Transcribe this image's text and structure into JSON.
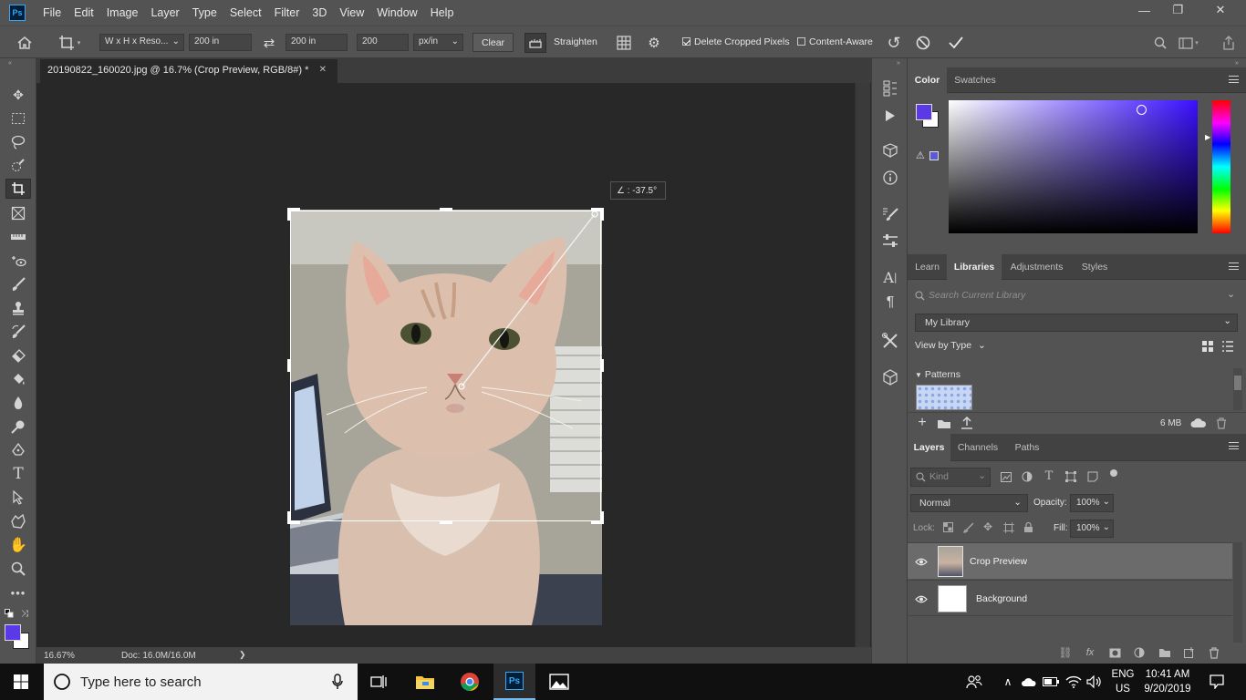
{
  "app": {
    "logo": "Ps"
  },
  "menu": [
    "File",
    "Edit",
    "Image",
    "Layer",
    "Type",
    "Select",
    "Filter",
    "3D",
    "View",
    "Window",
    "Help"
  ],
  "window_controls": {
    "minimize": "—",
    "restore": "❐",
    "close": "✕"
  },
  "options": {
    "ratio_preset": "W x H x Reso...",
    "width": "200 in",
    "height": "200 in",
    "resolution": "200",
    "resolution_unit": "px/in",
    "clear_label": "Clear",
    "straighten_label": "Straighten",
    "delete_cropped_label": "Delete Cropped Pixels",
    "delete_cropped_checked": true,
    "content_aware_label": "Content-Aware",
    "content_aware_checked": false
  },
  "document": {
    "tab_title": "20190822_160020.jpg @ 16.7% (Crop Preview, RGB/8#) *",
    "close": "✕",
    "angle_readout": "∠ : -37.5°"
  },
  "status": {
    "zoom": "16.67%",
    "doc": "Doc: 16.0M/16.0M",
    "arrow": "❯"
  },
  "color_panel": {
    "tabs": [
      "Color",
      "Swatches"
    ],
    "active_tab": "Color",
    "foreground": "#5b39e6",
    "background": "#ffffff"
  },
  "libraries_panel": {
    "tabs": [
      "Learn",
      "Libraries",
      "Adjustments",
      "Styles"
    ],
    "active_tab": "Libraries",
    "search_placeholder": "Search Current Library",
    "library": "My Library",
    "view_by": "View by Type",
    "section": "Patterns",
    "size": "6 MB"
  },
  "layers_panel": {
    "tabs": [
      "Layers",
      "Channels",
      "Paths"
    ],
    "active_tab": "Layers",
    "kind_placeholder": "Kind",
    "blend_mode": "Normal",
    "opacity_label": "Opacity:",
    "opacity": "100%",
    "lock_label": "Lock:",
    "fill_label": "Fill:",
    "fill": "100%",
    "layers": [
      {
        "name": "Crop Preview",
        "selected": true
      },
      {
        "name": "Background",
        "selected": false
      }
    ]
  },
  "taskbar": {
    "search_placeholder": "Type here to search",
    "lang_top": "ENG",
    "lang_bottom": "US",
    "time": "10:41 AM",
    "date": "9/20/2019"
  }
}
